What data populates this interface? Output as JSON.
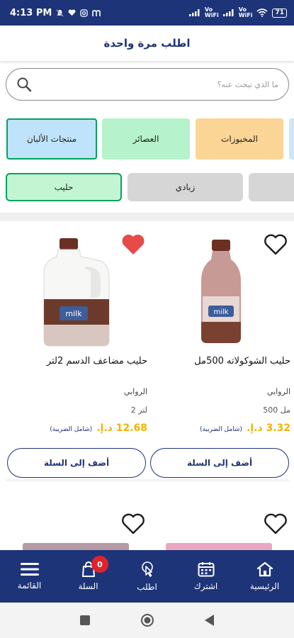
{
  "status": {
    "time": "4:13 PM",
    "net_left": "Vo",
    "net_left2": "WiFi",
    "net_right": "Vo",
    "net_right2": "WiFi",
    "battery": "71"
  },
  "header": {
    "title": "اطلب مرة واحدة"
  },
  "search": {
    "placeholder": "ما الذي تبحث عنه؟"
  },
  "categories": [
    {
      "label": "منتجات الألبان",
      "selected": true
    },
    {
      "label": "العصائر",
      "selected": false
    },
    {
      "label": "المخبوزات",
      "selected": false
    }
  ],
  "subcategories": [
    {
      "label": "حليب",
      "selected": true
    },
    {
      "label": "زبادي",
      "selected": false
    }
  ],
  "products": [
    {
      "name": "حليب الشوكولاته 500مل",
      "brand": "الروابي",
      "size": "مل 500",
      "price": "3.32 د.إ.",
      "tax_note": "(شامل الضريبة)",
      "add_label": "أضف إلى السلة",
      "favorite": false
    },
    {
      "name": "حليب مضاعف الدسم 2لتر",
      "brand": "الروابي",
      "size": "لتر 2",
      "price": "12.68 د.إ.",
      "tax_note": "(شامل الضريبة)",
      "add_label": "أضف إلى السلة",
      "favorite": true
    }
  ],
  "bottom_nav": {
    "home": "الرئيسية",
    "subscribe": "اشترك",
    "order": "اطلب",
    "cart": "السلة",
    "cart_count": "0",
    "menu": "القائمة"
  },
  "colors": {
    "primary": "#1e3478",
    "accent_price": "#f0b400",
    "selected_border": "#00a35e",
    "favorite": "#e84a4a"
  }
}
